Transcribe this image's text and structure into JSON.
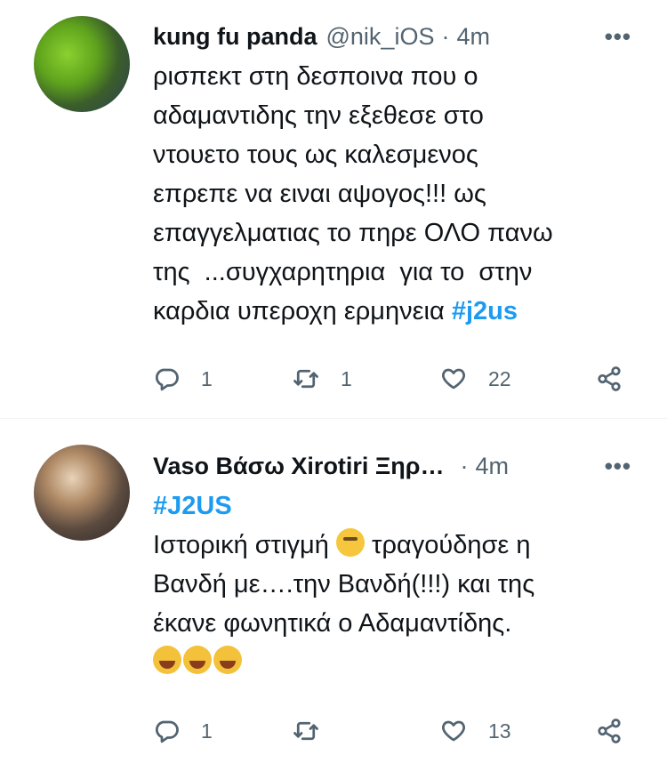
{
  "tweets": [
    {
      "name": "kung fu panda",
      "handle": "@nik_iOS",
      "separator": "·",
      "time": "4m",
      "more": "•••",
      "lines": [
        "ρισπεκτ στη δεσποινα που ο",
        "αδαμαντιδης την εξεθεσε στο",
        "ντουετο τους ως καλεσμενος",
        "επρεπε να ειναι αψογος!!! ως",
        "επαγγελματιας το πηρε ΟΛΟ πανω",
        "της  ...συγχαρητηρια  για το  στην",
        "καρδια υπεροχη ερμηνεια "
      ],
      "hashtag": "#j2us",
      "replies": "1",
      "retweets": "1",
      "likes": "22"
    },
    {
      "name": "Vaso Βάσω Xirotiri Ξηρ…",
      "separator": "·",
      "time": "4m",
      "more": "•••",
      "hashtag": "#J2US",
      "line1_before": "Ιστορική στιγμή ",
      "line1_after": " τραγούδησε η",
      "line2": "Βανδή με….την Βανδή(!!!) και της",
      "line3": "έκανε φωνητικά ο Αδαμαντίδης.",
      "emoji_think": "thinking-face-emoji",
      "emoji_laugh": "laughing-cat-emoji",
      "replies": "1",
      "retweets": "",
      "likes": "13"
    }
  ],
  "colors": {
    "text": "#0f1419",
    "secondary": "#536471",
    "hashtag": "#1d9bf0",
    "divider": "#eff3f4"
  }
}
